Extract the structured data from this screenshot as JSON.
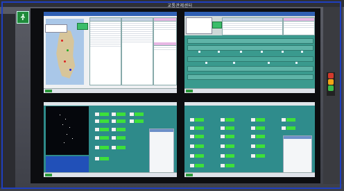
{
  "room": {
    "banner_text": "교통관제센터",
    "exit_sign": "exit-sign",
    "lamp_colors": [
      "#d33a2c",
      "#f2a516",
      "#3dbb4a"
    ]
  },
  "screens": {
    "top_left": {
      "title": "map-status-dashboard",
      "header_labels": [
        "",
        "",
        ""
      ],
      "green_button": "",
      "accent": "#3bbd6a"
    },
    "top_right": {
      "title": "lane-monitor",
      "accent": "#5fb4a8"
    },
    "bottom_left": {
      "title": "night-map-control",
      "accent": "#3de03a"
    },
    "bottom_right": {
      "title": "equipment-control",
      "accent": "#3de03a"
    }
  },
  "colors": {
    "frame": "#1f3fbf",
    "bezel": "#0c0d10",
    "teal_screen": "#2e8a8a",
    "table_head": "#c6d2e4",
    "table_head_pink": "#e7b7e4",
    "status_green": "#3de03a"
  }
}
